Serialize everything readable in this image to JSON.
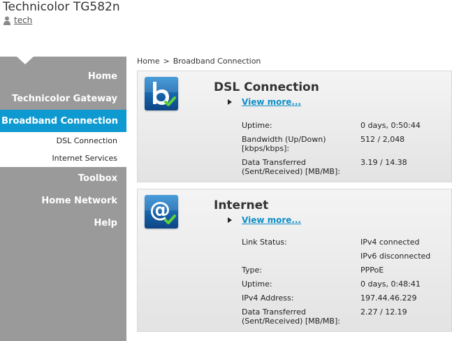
{
  "header": {
    "app_title": "Technicolor TG582n",
    "user": "tech"
  },
  "sidebar": {
    "items": [
      {
        "label": "Home"
      },
      {
        "label": "Technicolor Gateway"
      },
      {
        "label": "Broadband Connection"
      },
      {
        "label": "Toolbox"
      },
      {
        "label": "Home Network"
      },
      {
        "label": "Help"
      }
    ],
    "sub_items": [
      {
        "label": "DSL Connection"
      },
      {
        "label": "Internet Services"
      }
    ]
  },
  "breadcrumb": {
    "home": "Home",
    "separator": ">",
    "current": "Broadband Connection"
  },
  "dsl_card": {
    "icon": "broadband-b-check-icon",
    "title": "DSL Connection",
    "view_more": "View more...",
    "rows": [
      {
        "label": "Uptime:",
        "value": "0 days, 0:50:44"
      },
      {
        "label": "Bandwidth (Up/Down) [kbps/kbps]:",
        "value": "512 / 2,048"
      },
      {
        "label": "Data Transferred (Sent/Received) [MB/MB]:",
        "value": "3.19 / 14.38"
      }
    ]
  },
  "internet_card": {
    "icon": "at-sign-check-icon",
    "title": "Internet",
    "view_more": "View more...",
    "rows": [
      {
        "label": "Link Status:",
        "value": "IPv4 connected"
      },
      {
        "label": "",
        "value": "IPv6 disconnected"
      },
      {
        "label": "Type:",
        "value": "PPPoE"
      },
      {
        "label": "Uptime:",
        "value": "0 days, 0:48:41"
      },
      {
        "label": "IPv4 Address:",
        "value": "197.44.46.229"
      },
      {
        "label": "Data Transferred (Sent/Received) [MB/MB]:",
        "value": "2.27 / 12.19"
      }
    ]
  },
  "colors": {
    "sidebar_bg": "#9a9a9a",
    "active_nav": "#0e9ad0",
    "link": "#0e8fc8"
  }
}
